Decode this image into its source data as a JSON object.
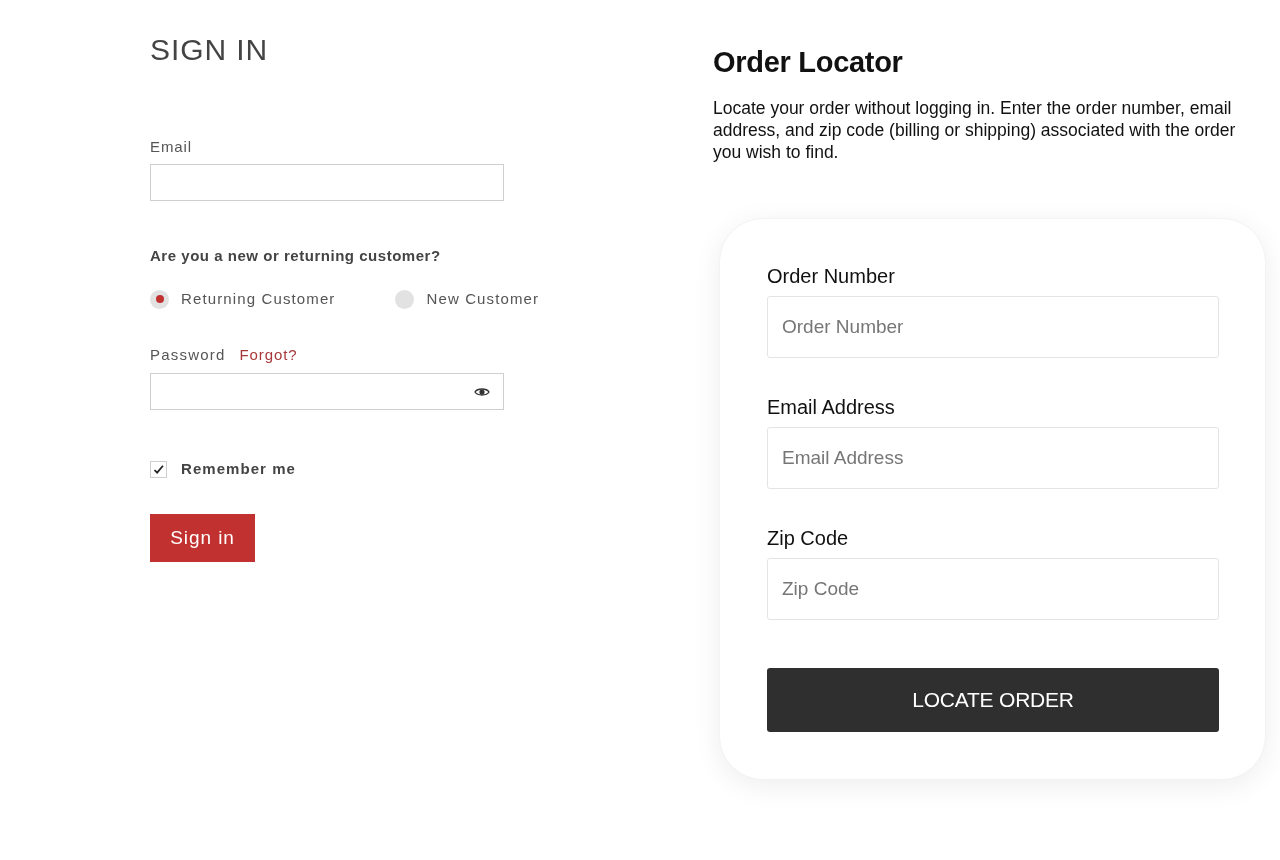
{
  "sign_in": {
    "title": "SIGN IN",
    "email": {
      "label": "Email"
    },
    "customer_type": {
      "question": "Are you a new or returning customer?",
      "options": [
        {
          "label": "Returning Customer",
          "selected": true
        },
        {
          "label": "New Customer",
          "selected": false
        }
      ]
    },
    "password": {
      "label": "Password",
      "forgot_link": "Forgot?"
    },
    "remember_me": {
      "label": "Remember me",
      "checked": true
    },
    "button": "Sign in"
  },
  "order_locator": {
    "title": "Order Locator",
    "description": "Locate your order without logging in. Enter the order number, email address, and zip code (billing or shipping) associated with the order you wish to find.",
    "fields": [
      {
        "label": "Order Number",
        "placeholder": "Order Number"
      },
      {
        "label": "Email Address",
        "placeholder": "Email Address"
      },
      {
        "label": "Zip Code",
        "placeholder": "Zip Code"
      }
    ],
    "button": "LOCATE ORDER"
  }
}
